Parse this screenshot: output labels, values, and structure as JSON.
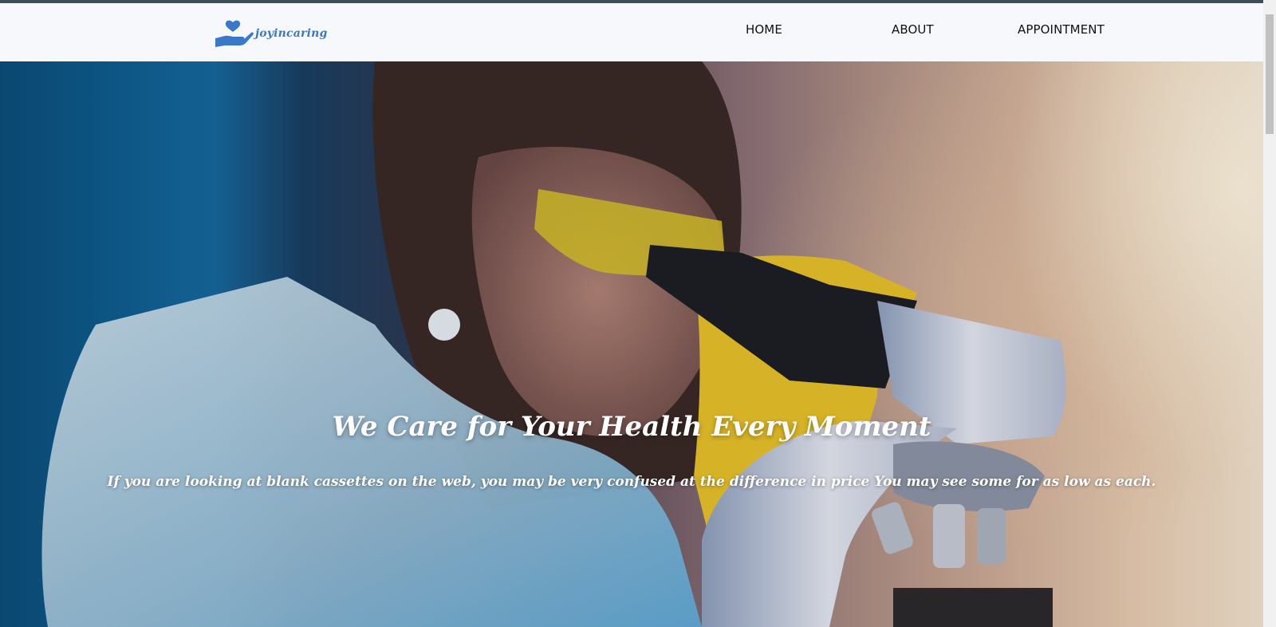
{
  "brand": {
    "name": "joyincaring",
    "icon": "heart-in-hand-icon",
    "color": "#3a78c9"
  },
  "nav": {
    "items": [
      {
        "label": "HOME"
      },
      {
        "label": "ABOUT"
      },
      {
        "label": "APPOINTMENT"
      }
    ]
  },
  "hero": {
    "title": "We Care for Your Health Every Moment",
    "subtitle": "If you are looking at blank cassettes on the web, you may be very confused at the difference in price You may see some for as low as each.",
    "image": "scientist-with-microscope-photo"
  }
}
